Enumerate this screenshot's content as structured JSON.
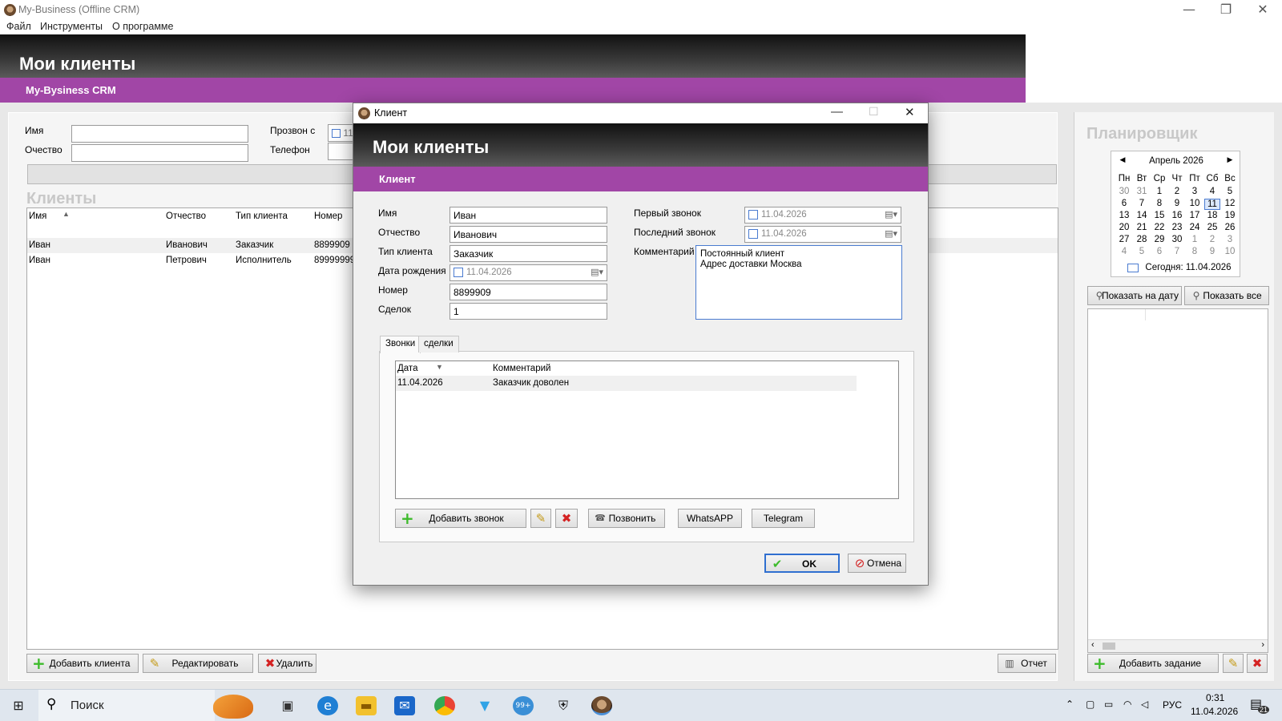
{
  "window": {
    "title": "My-Business (Offline CRM)",
    "min": "—",
    "restore": "❐",
    "close": "✕"
  },
  "menu": [
    "Файл",
    "Инструменты",
    "О программе"
  ],
  "header": {
    "title": "Мои клиенты",
    "subtitle": "My-Bysiness CRM"
  },
  "filters": {
    "name_label": "Имя",
    "patronymic_label": "Очество",
    "call_from_label": "Прозвон с",
    "call_from_value": "11",
    "phone_label": "Телефон"
  },
  "clients": {
    "section_title": "Клиенты",
    "columns": [
      "Имя",
      "Отчество",
      "Тип клиента",
      "Номер"
    ],
    "rows": [
      [
        "Иван",
        "Иванович",
        "Заказчик",
        "8899909"
      ],
      [
        "Иван",
        "Петрович",
        "Исполнитель",
        "89999999"
      ]
    ]
  },
  "bottom_buttons": {
    "add": "Добавить клиента",
    "edit": "Редактировать",
    "delete": "Удалить",
    "report": "Отчет"
  },
  "planner": {
    "title": "Планировщик",
    "month": "Апрель 2026",
    "weekdays": [
      "Пн",
      "Вт",
      "Ср",
      "Чт",
      "Пт",
      "Сб",
      "Вс"
    ],
    "weeks": [
      [
        "30",
        "31",
        "1",
        "2",
        "3",
        "4",
        "5"
      ],
      [
        "6",
        "7",
        "8",
        "9",
        "10",
        "11",
        "12"
      ],
      [
        "13",
        "14",
        "15",
        "16",
        "17",
        "18",
        "19"
      ],
      [
        "20",
        "21",
        "22",
        "23",
        "24",
        "25",
        "26"
      ],
      [
        "27",
        "28",
        "29",
        "30",
        "1",
        "2",
        "3"
      ],
      [
        "4",
        "5",
        "6",
        "7",
        "8",
        "9",
        "10"
      ]
    ],
    "today_label": "Сегодня: 11.04.2026",
    "show_on_date": "Показать на дату",
    "show_all": "Показать все",
    "add_task": "Добавить задание"
  },
  "dialog": {
    "title": "Клиент",
    "header": "Мои клиенты",
    "subheader": "Клиент",
    "fields": {
      "name_label": "Имя",
      "name_value": "Иван",
      "patronymic_label": "Отчество",
      "patronymic_value": "Иванович",
      "type_label": "Тип клиента",
      "type_value": "Заказчик",
      "birth_label": "Дата рождения",
      "birth_value": "11.04.2026",
      "number_label": "Номер",
      "number_value": "8899909",
      "deals_label": "Сделок",
      "deals_value": "1",
      "first_call_label": "Первый звонок",
      "first_call_value": "11.04.2026",
      "last_call_label": "Последний звонок",
      "last_call_value": "11.04.2026",
      "comment_label": "Комментарий",
      "comment_value": "Постоянный клиент\nАдрес доставки Москва"
    },
    "tabs": [
      "Звонки",
      "сделки"
    ],
    "calls": {
      "columns": [
        "Дата",
        "Комментарий"
      ],
      "rows": [
        [
          "11.04.2026",
          "Заказчик доволен"
        ]
      ]
    },
    "buttons": {
      "add_call": "Добавить звонок",
      "call": "Позвонить",
      "whatsapp": "WhatsAPP",
      "telegram": "Telegram",
      "ok": "OK",
      "cancel": "Отмена"
    }
  },
  "taskbar": {
    "search": "Поиск",
    "lang": "РУС",
    "time": "0:31",
    "date": "11.04.2026",
    "notif": "21",
    "badge": "99+"
  }
}
